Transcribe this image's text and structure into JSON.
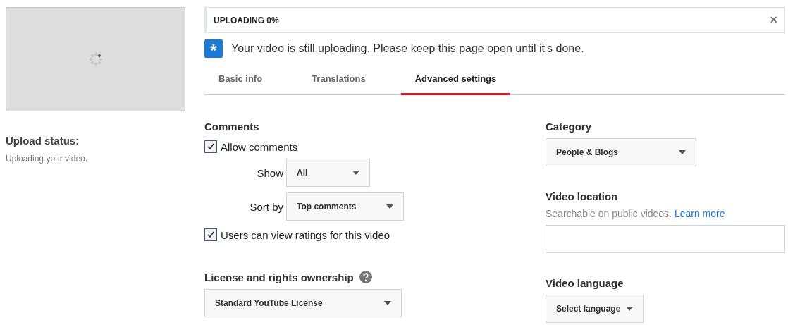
{
  "thumbnail": {
    "kind": "loading"
  },
  "upload_status": {
    "title": "Upload status:",
    "text": "Uploading your video."
  },
  "progress": {
    "label": "UPLOADING 0%",
    "level": 0,
    "close": "×"
  },
  "notice": {
    "icon": "*",
    "text": "Your video is still uploading. Please keep this page open until it's done."
  },
  "tabs": [
    {
      "label": "Basic info",
      "selected": false
    },
    {
      "label": "Translations",
      "selected": false
    },
    {
      "label": "Advanced settings",
      "selected": true
    }
  ],
  "comments": {
    "title": "Comments",
    "allow": {
      "label": "Allow comments",
      "checked": true
    },
    "show": {
      "label": "Show",
      "value": "All"
    },
    "sort_by": {
      "label": "Sort by",
      "value": "Top comments"
    },
    "ratings": {
      "label": "Users can view ratings for this video",
      "checked": true
    }
  },
  "license": {
    "title": "License and rights ownership",
    "value": "Standard YouTube License"
  },
  "category": {
    "title": "Category",
    "value": "People & Blogs"
  },
  "video_location": {
    "title": "Video location",
    "hint": "Searchable on public videos.",
    "link": "Learn more"
  },
  "video_language": {
    "title": "Video language",
    "value": "Select language"
  }
}
